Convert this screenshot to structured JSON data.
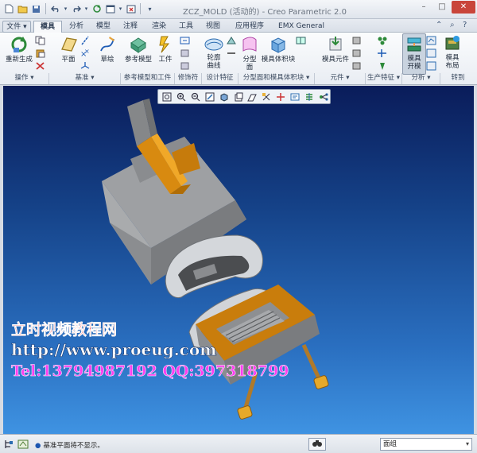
{
  "window": {
    "title": "ZCZ_MOLD (活动的) - Creo Parametric 2.0",
    "controls": {
      "minimize": "–",
      "maximize": "□",
      "close": "✕"
    }
  },
  "quick_access": [
    "new-icon",
    "open-icon",
    "save-icon",
    "undo-icon",
    "redo-icon",
    "regenerate-icon",
    "windows-icon",
    "close-window-icon",
    "customize-icon"
  ],
  "tabs": [
    {
      "label": "文件",
      "key": "file"
    },
    {
      "label": "模具",
      "key": "mold",
      "active": true
    },
    {
      "label": "分析",
      "key": "analysis"
    },
    {
      "label": "模型",
      "key": "model"
    },
    {
      "label": "注释",
      "key": "annotate"
    },
    {
      "label": "渲染",
      "key": "render"
    },
    {
      "label": "工具",
      "key": "tools"
    },
    {
      "label": "视图",
      "key": "view"
    },
    {
      "label": "应用程序",
      "key": "applications"
    },
    {
      "label": "EMX General",
      "key": "emx"
    }
  ],
  "ribbon": {
    "buttons": {
      "regenerate": "重新生成",
      "plane": "平面",
      "sketch": "草绘",
      "ref_model": "参考模型",
      "workpiece": "工件",
      "trim_curve": "轮廓\n曲线",
      "parting_surface": "分型\n面",
      "mold_volume": "模具体积块",
      "mold_component": "模具元件",
      "mold_open": "模具\n开模",
      "mold_layout": "模具\n布局"
    },
    "groups": [
      "操作 ▾",
      "基准 ▾",
      "参考模型和工件",
      "修饰符",
      "设计特征",
      "分型面和模具体积块 ▾",
      "元件 ▾",
      "生产特征 ▾",
      "分析 ▾",
      "转到"
    ]
  },
  "view_toolbar": [
    "refit-icon",
    "zoom-in-icon",
    "zoom-out-icon",
    "repaint-icon",
    "display-style-icon",
    "saved-views-icon",
    "perspective-icon",
    "datum-display-icon",
    "spin-center-icon",
    "annotation-display-icon",
    "layer-icon",
    "explode-icon"
  ],
  "watermark": {
    "line1": "立时视频教程网",
    "line2": "http://www.proeug.com",
    "line3": "Tel:13794987192  QQ:397318799"
  },
  "status": {
    "message": "基准平面将不显示。",
    "filter": "面组",
    "filter_arrow": "▾"
  },
  "colors": {
    "viewport_top": "#0a1c5a",
    "viewport_bottom": "#3f93e2",
    "part_gray": "#7d7d7d",
    "part_orange": "#d88a10"
  }
}
